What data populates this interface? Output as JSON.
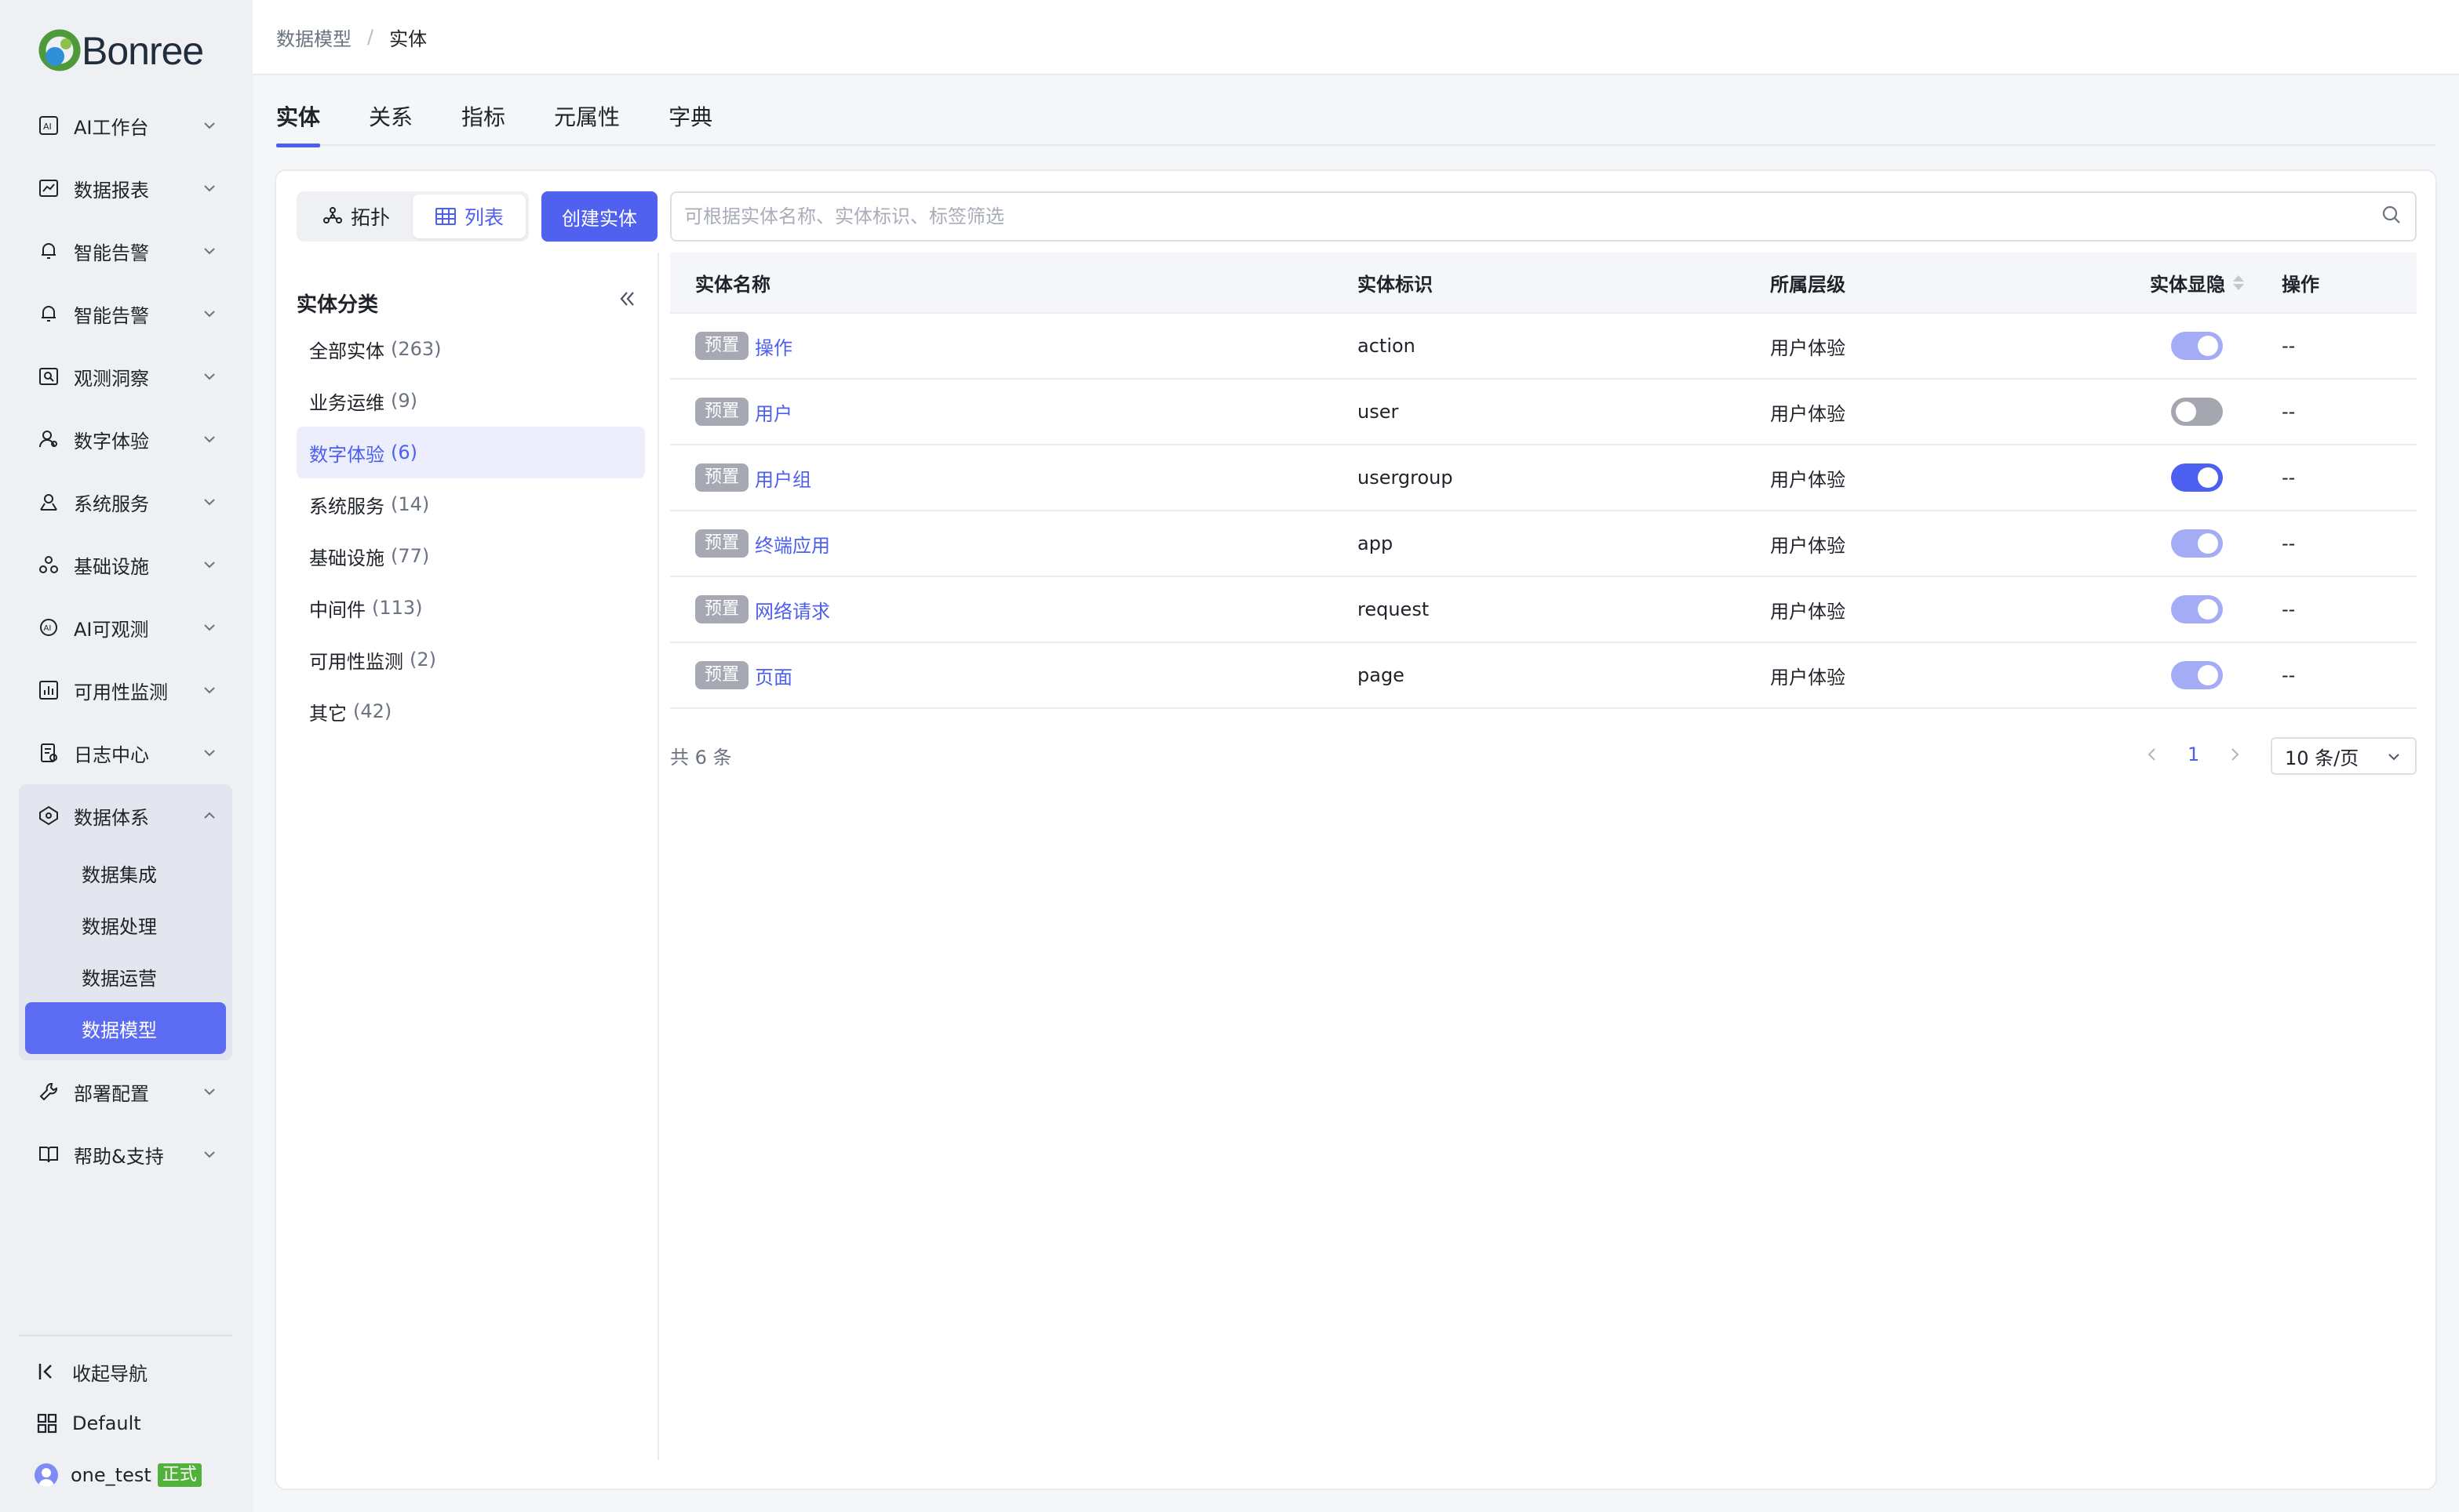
{
  "brand": {
    "name": "Bonree"
  },
  "sidebar": {
    "items": [
      {
        "label": "AI工作台",
        "icon": "ai-workbench-icon"
      },
      {
        "label": "数据报表",
        "icon": "report-chart-icon"
      },
      {
        "label": "智能告警",
        "icon": "alert-bell-icon"
      },
      {
        "label": "智能告警",
        "icon": "alert-bell-icon"
      },
      {
        "label": "观测洞察",
        "icon": "insight-search-icon"
      },
      {
        "label": "数字体验",
        "icon": "user-experience-icon"
      },
      {
        "label": "系统服务",
        "icon": "system-service-icon"
      },
      {
        "label": "基础设施",
        "icon": "infrastructure-icon"
      },
      {
        "label": "AI可观测",
        "icon": "ai-observe-icon"
      },
      {
        "label": "可用性监测",
        "icon": "availability-chart-icon"
      },
      {
        "label": "日志中心",
        "icon": "log-doc-icon"
      }
    ],
    "expanded_group": {
      "label": "数据体系",
      "icon": "data-system-icon",
      "children": [
        "数据集成",
        "数据处理",
        "数据运营",
        "数据模型"
      ],
      "active_child": "数据模型"
    },
    "after_items": [
      {
        "label": "部署配置",
        "icon": "wrench-icon"
      },
      {
        "label": "帮助&支持",
        "icon": "book-icon"
      }
    ],
    "collapse_label": "收起导航",
    "workspace_label": "Default",
    "user_name": "one_test",
    "env_badge": "正式"
  },
  "breadcrumb": {
    "parent": "数据模型",
    "separator": "/",
    "current": "实体"
  },
  "tabs": [
    "实体",
    "关系",
    "指标",
    "元属性",
    "字典"
  ],
  "active_tab": "实体",
  "toolbar": {
    "view_topology": "拓扑",
    "view_list": "列表",
    "active_view": "列表",
    "create_button": "创建实体",
    "search_placeholder": "可根据实体名称、实体标识、标签筛选"
  },
  "categories": {
    "title": "实体分类",
    "items": [
      {
        "label": "全部实体",
        "count": "(263)"
      },
      {
        "label": "业务运维",
        "count": "(9)"
      },
      {
        "label": "数字体验",
        "count": "(6)"
      },
      {
        "label": "系统服务",
        "count": "(14)"
      },
      {
        "label": "基础设施",
        "count": "(77)"
      },
      {
        "label": "中间件",
        "count": "(113)"
      },
      {
        "label": "可用性监测",
        "count": "(2)"
      },
      {
        "label": "其它",
        "count": "(42)"
      }
    ],
    "active": "数字体验"
  },
  "table": {
    "headers": [
      "实体名称",
      "实体标识",
      "所属层级",
      "实体显隐",
      "操作"
    ],
    "rows": [
      {
        "tag": "预置",
        "name": "操作",
        "id": "action",
        "layer": "用户体验",
        "visible": "on-light",
        "action": "--"
      },
      {
        "tag": "预置",
        "name": "用户",
        "id": "user",
        "layer": "用户体验",
        "visible": "off",
        "action": "--"
      },
      {
        "tag": "预置",
        "name": "用户组",
        "id": "usergroup",
        "layer": "用户体验",
        "visible": "on-dark",
        "action": "--"
      },
      {
        "tag": "预置",
        "name": "终端应用",
        "id": "app",
        "layer": "用户体验",
        "visible": "on-light",
        "action": "--"
      },
      {
        "tag": "预置",
        "name": "网络请求",
        "id": "request",
        "layer": "用户体验",
        "visible": "on-light",
        "action": "--"
      },
      {
        "tag": "预置",
        "name": "页面",
        "id": "page",
        "layer": "用户体验",
        "visible": "on-light",
        "action": "--"
      }
    ]
  },
  "pagination": {
    "total_text": "共 6 条",
    "current_page": "1",
    "page_size": "10 条/页"
  },
  "colors": {
    "accent": "#4c5ff0",
    "sidebar_bg": "#eef0f4",
    "active_nav": "#5b6cf2",
    "tag_bg": "#a6a9b3",
    "env_badge": "#52b13b"
  }
}
